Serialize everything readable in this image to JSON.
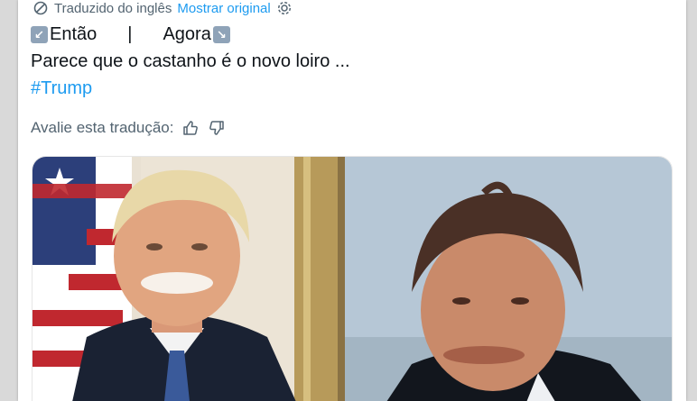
{
  "translation": {
    "translated_from": "Traduzido do inglês",
    "show_original": "Mostrar original",
    "icon": "translate-icon",
    "settings_icon": "gear-icon"
  },
  "tweet": {
    "before_label": "Então",
    "separator": "|",
    "after_label": "Agora",
    "before_emoji": "↙",
    "after_emoji": "↘",
    "body": "Parece que o castanho é o novo loiro ...",
    "hashtag": "#Trump"
  },
  "rating": {
    "prompt": "Avalie esta tradução:",
    "thumbs_up_icon": "thumbs-up-icon",
    "thumbs_down_icon": "thumbs-down-icon"
  },
  "colors": {
    "link": "#1d9bf0",
    "secondary_text": "#536471",
    "primary_text": "#0f1419"
  }
}
